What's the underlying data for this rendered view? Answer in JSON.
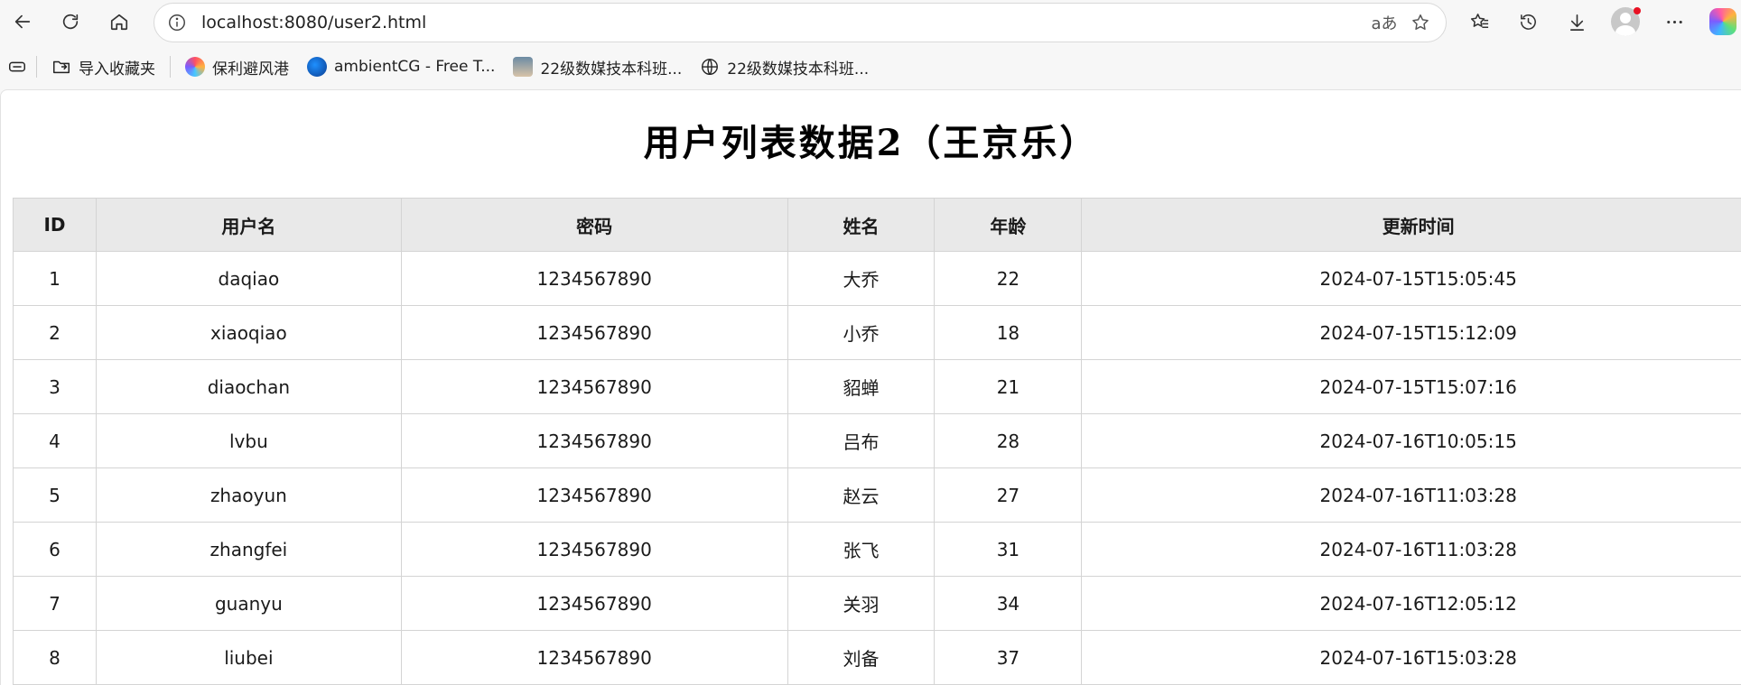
{
  "browser": {
    "url": "localhost:8080/user2.html",
    "read_aloud_label": "aあ",
    "icons": [
      "back-icon",
      "refresh-icon",
      "home-icon",
      "info-icon",
      "read-aloud-icon",
      "favorite-star-icon",
      "favorites-icon",
      "history-icon",
      "download-icon",
      "profile-icon",
      "more-icon",
      "copilot-icon"
    ]
  },
  "bookmarks": [
    {
      "label": "导入收藏夹"
    },
    {
      "label": "保利避风港"
    },
    {
      "label": "ambientCG - Free T..."
    },
    {
      "label": "22级数媒技本科班..."
    },
    {
      "label": "22级数媒技本科班..."
    }
  ],
  "page": {
    "title": "用户列表数据2（王京乐）",
    "table": {
      "headers": [
        "ID",
        "用户名",
        "密码",
        "姓名",
        "年龄",
        "更新时间"
      ],
      "rows": [
        [
          "1",
          "daqiao",
          "1234567890",
          "大乔",
          "22",
          "2024-07-15T15:05:45"
        ],
        [
          "2",
          "xiaoqiao",
          "1234567890",
          "小乔",
          "18",
          "2024-07-15T15:12:09"
        ],
        [
          "3",
          "diaochan",
          "1234567890",
          "貂蝉",
          "21",
          "2024-07-15T15:07:16"
        ],
        [
          "4",
          "lvbu",
          "1234567890",
          "吕布",
          "28",
          "2024-07-16T10:05:15"
        ],
        [
          "5",
          "zhaoyun",
          "1234567890",
          "赵云",
          "27",
          "2024-07-16T11:03:28"
        ],
        [
          "6",
          "zhangfei",
          "1234567890",
          "张飞",
          "31",
          "2024-07-16T11:03:28"
        ],
        [
          "7",
          "guanyu",
          "1234567890",
          "关羽",
          "34",
          "2024-07-16T12:05:12"
        ],
        [
          "8",
          "liubei",
          "1234567890",
          "刘备",
          "37",
          "2024-07-16T15:03:28"
        ]
      ]
    }
  },
  "colors": {
    "header_bg": "#e9e9e9",
    "border": "#d4d4d4",
    "notification_dot": "#e81123"
  }
}
